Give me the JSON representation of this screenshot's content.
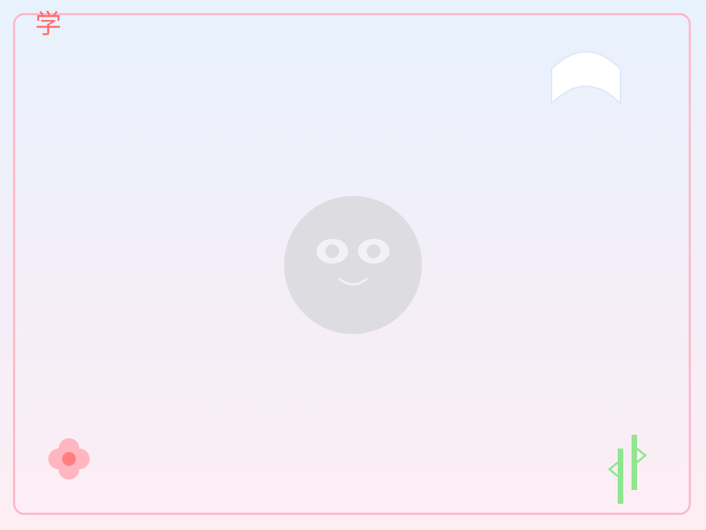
{
  "scene": {
    "corner_character": "学",
    "icons": {
      "book": "open-book-icon",
      "face": "smiling-face-icon",
      "flower": "flower-icon",
      "bamboo": "bamboo-icon"
    },
    "colors": {
      "frame_border": "#ffb7c8",
      "character": "#ff6b6b",
      "face_fill": "#dcdce1",
      "face_features": "#f2f2f5",
      "flower_petals": "#ffb6c1",
      "flower_center": "#ff7f7f",
      "bamboo": "#8ee68e",
      "book_fill": "#ffffff",
      "book_outline": "#dfe6f6"
    }
  }
}
